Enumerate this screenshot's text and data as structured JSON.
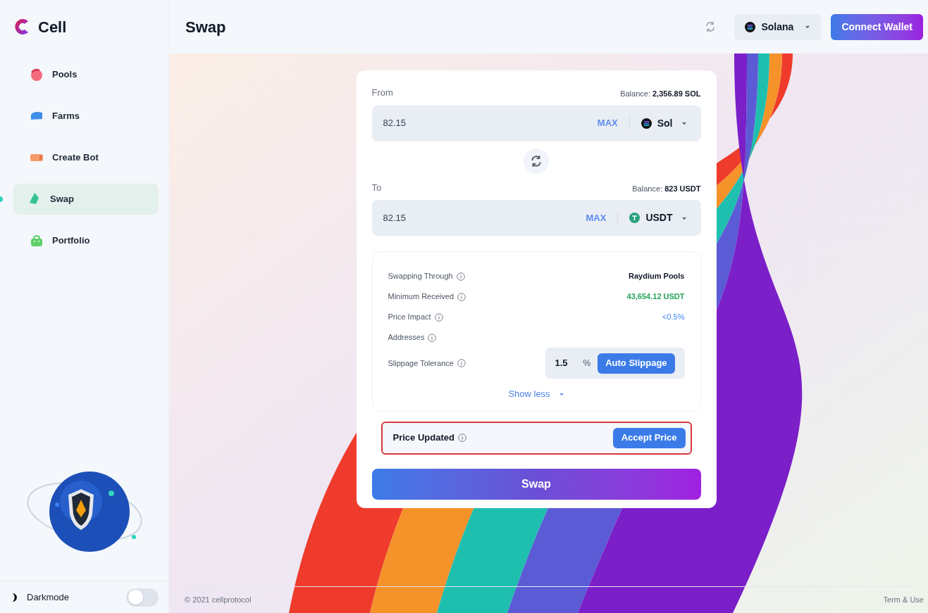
{
  "brand": {
    "name": "Cell"
  },
  "sidebar": {
    "items": [
      {
        "label": "Pools",
        "selected": false,
        "color": "#f26b7a"
      },
      {
        "label": "Farms",
        "selected": false,
        "color": "#3d8ee8"
      },
      {
        "label": "Create Bot",
        "selected": false,
        "color": "#f59a6b"
      },
      {
        "label": "Swap",
        "selected": true,
        "color": "#34c38f"
      },
      {
        "label": "Portfolio",
        "selected": false,
        "color": "#5fcf6a"
      }
    ]
  },
  "darkmode": {
    "label": "Darkmode",
    "on": false
  },
  "header": {
    "title": "Swap",
    "network": "Solana",
    "connect_button": "Connect Wallet"
  },
  "swap": {
    "from": {
      "label": "From",
      "balance_label": "Balance:",
      "balance": "2,356.89 SOL",
      "amount": "82.15",
      "max": "MAX",
      "token": "Sol",
      "kind": "sol"
    },
    "to": {
      "label": "To",
      "balance_label": "Balance:",
      "balance": "823 USDT",
      "amount": "82.15",
      "max": "MAX",
      "token": "USDT",
      "kind": "usdt"
    },
    "details": [
      {
        "label": "Swapping Through",
        "value": "Raydium Pools",
        "kind": "default"
      },
      {
        "label": "Minimum Received",
        "value": "43,654.12 USDT",
        "kind": "positive"
      },
      {
        "label": "Price Impact",
        "value": "<0.5%",
        "kind": "accent"
      },
      {
        "label": "Addresses"
      }
    ],
    "slippage": {
      "label": "Slippage Tolerance",
      "value": "1.5",
      "unit": "%",
      "button": "Auto Slippage"
    },
    "toggle": "Show less",
    "price_updated": {
      "label": "Price Updated",
      "button": "Accept Price"
    },
    "swap_button": "Swap"
  },
  "footer": {
    "copyright": "© 2021 cellprotocol",
    "link": "Term & Use"
  }
}
